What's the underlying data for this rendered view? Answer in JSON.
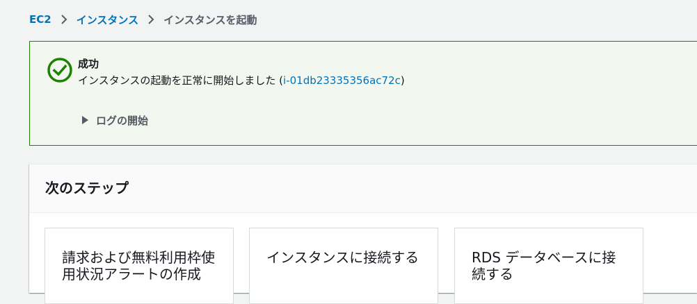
{
  "breadcrumb": {
    "items": [
      "EC2",
      "インスタンス"
    ],
    "current": "インスタンスを起動"
  },
  "flash": {
    "type": "success",
    "title": "成功",
    "message_prefix": "インスタンスの起動を正常に開始しました (",
    "instance_id": "i-01db23335356ac72c",
    "message_suffix": ")",
    "log_toggle_label": "ログの開始",
    "icon": "check-circle-icon"
  },
  "next_steps": {
    "title": "次のステップ",
    "cards": [
      {
        "title": "請求および無料利用枠使用状況アラートの作成"
      },
      {
        "title": "インスタンスに接続する"
      },
      {
        "title": "RDS データベースに接続する"
      }
    ]
  },
  "colors": {
    "link": "#0073bb",
    "success": "#1d8102",
    "success_bg": "#f2f8f0",
    "page_bg": "#f2f3f3",
    "muted": "#545b64"
  }
}
